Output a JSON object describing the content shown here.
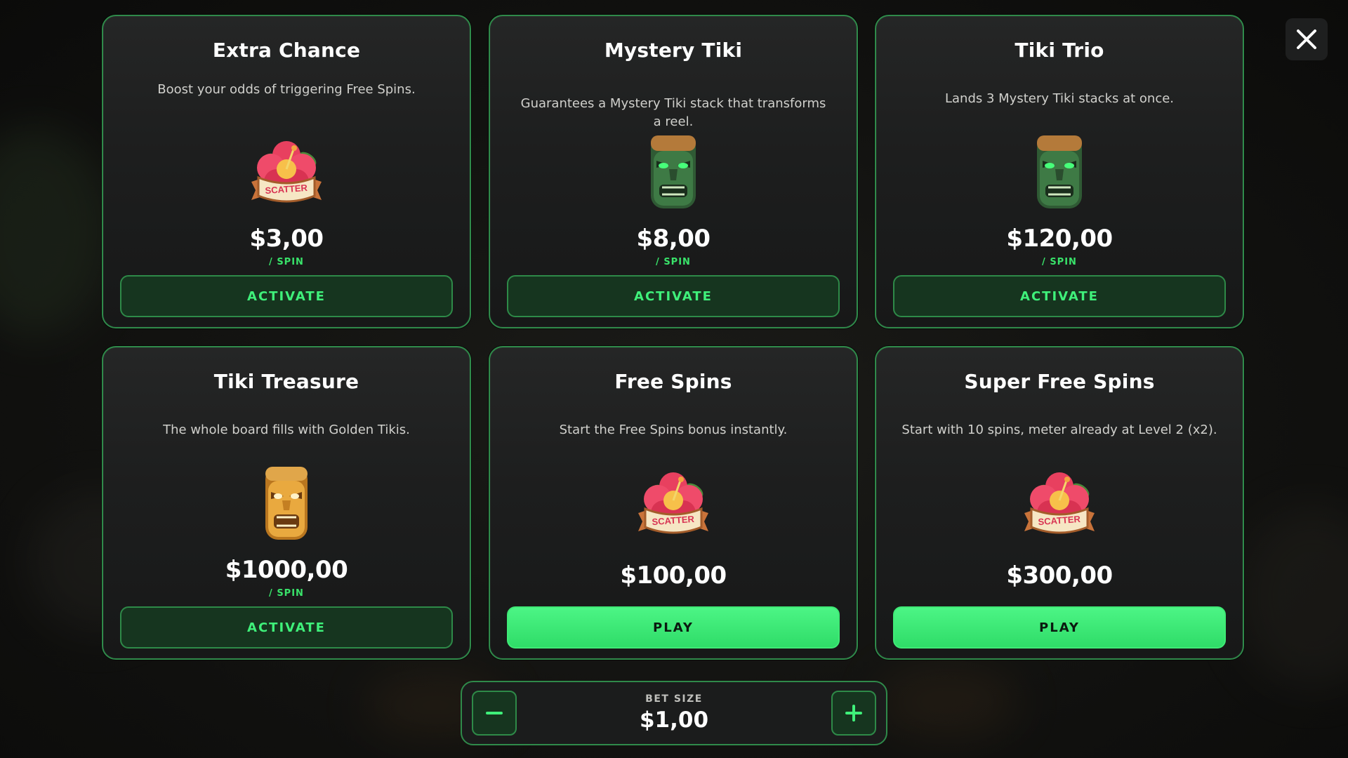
{
  "close_button": {
    "icon": "close-icon"
  },
  "cards": [
    {
      "title": "Extra Chance",
      "description": "Boost your odds of triggering Free Spins.",
      "icon": "scatter-hibiscus-icon",
      "price": "$3,00",
      "unit": "/ SPIN",
      "button": "ACTIVATE"
    },
    {
      "title": "Mystery Tiki",
      "description": "Guarantees a Mystery Tiki stack that transforms a reel.",
      "icon": "green-tiki-mask-icon",
      "price": "$8,00",
      "unit": "/ SPIN",
      "button": "ACTIVATE"
    },
    {
      "title": "Tiki Trio",
      "description": "Lands 3 Mystery Tiki stacks at once.",
      "icon": "green-tiki-mask-icon",
      "price": "$120,00",
      "unit": "/ SPIN",
      "button": "ACTIVATE"
    },
    {
      "title": "Tiki Treasure",
      "description": "The whole board fills with Golden Tikis.",
      "icon": "golden-tiki-mask-icon",
      "price": "$1000,00",
      "unit": "/ SPIN",
      "button": "ACTIVATE"
    },
    {
      "title": "Free Spins",
      "description": "Start the Free Spins bonus instantly.",
      "icon": "scatter-hibiscus-icon",
      "price": "$100,00",
      "button": "PLAY"
    },
    {
      "title": "Super Free Spins",
      "description": "Start with 10 spins, meter already at Level 2 (x2).",
      "icon": "scatter-hibiscus-icon",
      "price": "$300,00",
      "button": "PLAY"
    }
  ],
  "bet": {
    "label": "BET SIZE",
    "value": "$1,00",
    "minus_icon": "minus-icon",
    "plus_icon": "plus-icon"
  },
  "colors": {
    "accent_green": "#3ff07a",
    "card_border": "#2f8a4a",
    "play_green": "#3ee875"
  },
  "scatter_label": "SCATTER"
}
